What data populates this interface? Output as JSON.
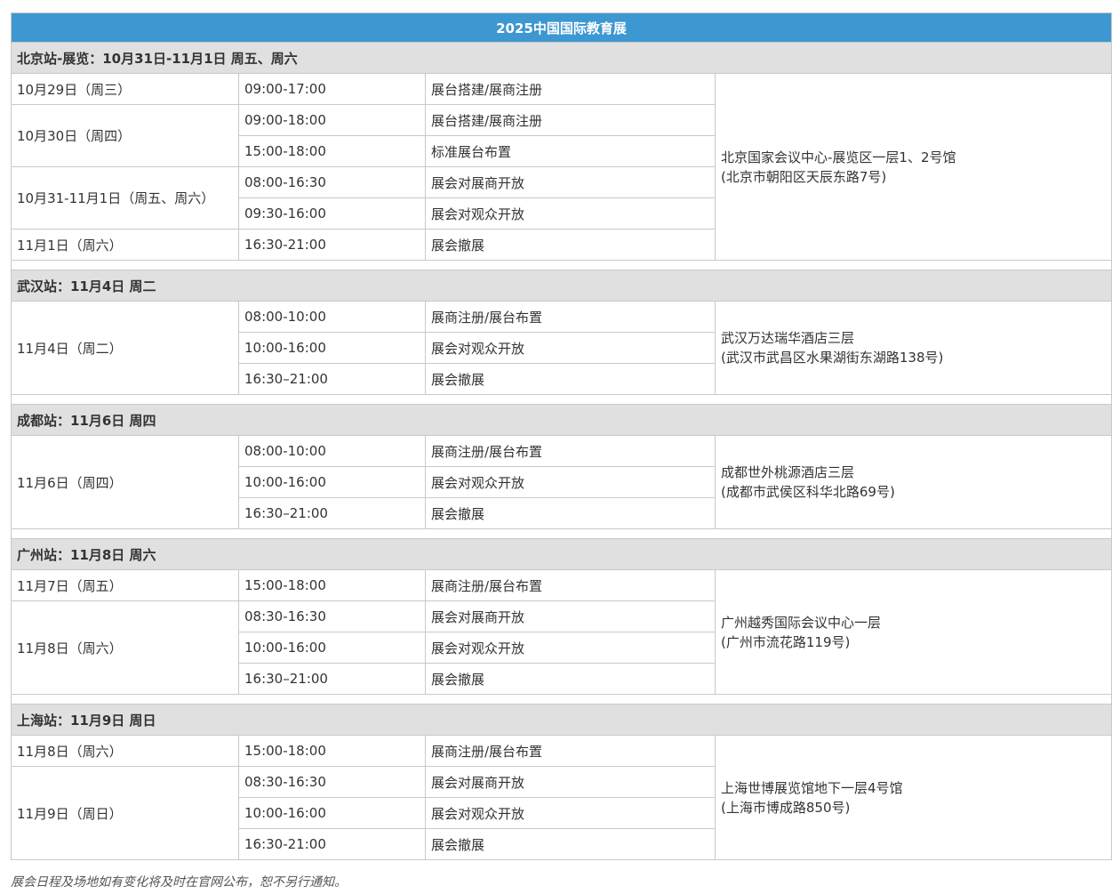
{
  "title": "2025中国国际教育展",
  "stations": [
    {
      "heading": "北京站-展览：10月31日-11月1日 周五、周六",
      "venue_line1": "北京国家会议中心-展览区一层1、2号馆",
      "venue_line2": "(北京市朝阳区天辰东路7号)",
      "rows": [
        {
          "date": "10月29日（周三）",
          "date_span": 1,
          "time": "09:00-17:00",
          "activity": "展台搭建/展商注册"
        },
        {
          "date": "10月30日（周四）",
          "date_span": 2,
          "time": "09:00-18:00",
          "activity": "展台搭建/展商注册"
        },
        {
          "date": null,
          "time": "15:00-18:00",
          "activity": "标准展台布置"
        },
        {
          "date": "10月31-11月1日（周五、周六）",
          "date_span": 2,
          "time": "08:00-16:30",
          "activity": "展会对展商开放"
        },
        {
          "date": null,
          "time": "09:30-16:00",
          "activity": "展会对观众开放"
        },
        {
          "date": "11月1日（周六）",
          "date_span": 1,
          "time": "16:30-21:00",
          "activity": "展会撤展"
        }
      ]
    },
    {
      "heading": "武汉站：11月4日 周二",
      "venue_line1": "武汉万达瑞华酒店三层",
      "venue_line2": "(武汉市武昌区水果湖街东湖路138号)",
      "rows": [
        {
          "date": "11月4日（周二）",
          "date_span": 3,
          "time": "08:00-10:00",
          "activity": "展商注册/展台布置"
        },
        {
          "date": null,
          "time": "10:00-16:00",
          "activity": "展会对观众开放"
        },
        {
          "date": null,
          "time": "16:30–21:00",
          "activity": "展会撤展"
        }
      ]
    },
    {
      "heading": "成都站：11月6日 周四",
      "venue_line1": "成都世外桃源酒店三层",
      "venue_line2": "(成都市武侯区科华北路69号)",
      "rows": [
        {
          "date": "11月6日（周四）",
          "date_span": 3,
          "time": "08:00-10:00",
          "activity": "展商注册/展台布置"
        },
        {
          "date": null,
          "time": "10:00-16:00",
          "activity": "展会对观众开放"
        },
        {
          "date": null,
          "time": "16:30–21:00",
          "activity": "展会撤展"
        }
      ]
    },
    {
      "heading": "广州站：11月8日 周六",
      "venue_line1": "广州越秀国际会议中心一层",
      "venue_line2": "(广州市流花路119号)",
      "rows": [
        {
          "date": "11月7日（周五）",
          "date_span": 1,
          "time": "15:00-18:00",
          "activity": "展商注册/展台布置"
        },
        {
          "date": "11月8日（周六）",
          "date_span": 3,
          "time": "08:30-16:30",
          "activity": "展会对展商开放"
        },
        {
          "date": null,
          "time": "10:00-16:00",
          "activity": "展会对观众开放"
        },
        {
          "date": null,
          "time": "16:30–21:00",
          "activity": "展会撤展"
        }
      ]
    },
    {
      "heading": "上海站：11月9日 周日",
      "venue_line1": "上海世博展览馆地下一层4号馆",
      "venue_line2": "(上海市博成路850号)",
      "rows": [
        {
          "date": "11月8日（周六）",
          "date_span": 1,
          "time": "15:00-18:00",
          "activity": "展商注册/展台布置"
        },
        {
          "date": "11月9日（周日）",
          "date_span": 3,
          "time": "08:30-16:30",
          "activity": "展会对展商开放"
        },
        {
          "date": null,
          "time": "10:00-16:00",
          "activity": "展会对观众开放"
        },
        {
          "date": null,
          "time": "16:30-21:00",
          "activity": "展会撤展"
        }
      ]
    }
  ],
  "footnote": "展会日程及场地如有变化将及时在官网公布，恕不另行通知。",
  "colors": {
    "title_bg": "#3d97d1",
    "station_bg": "#e0e0e0",
    "border": "#c9c9c9"
  }
}
